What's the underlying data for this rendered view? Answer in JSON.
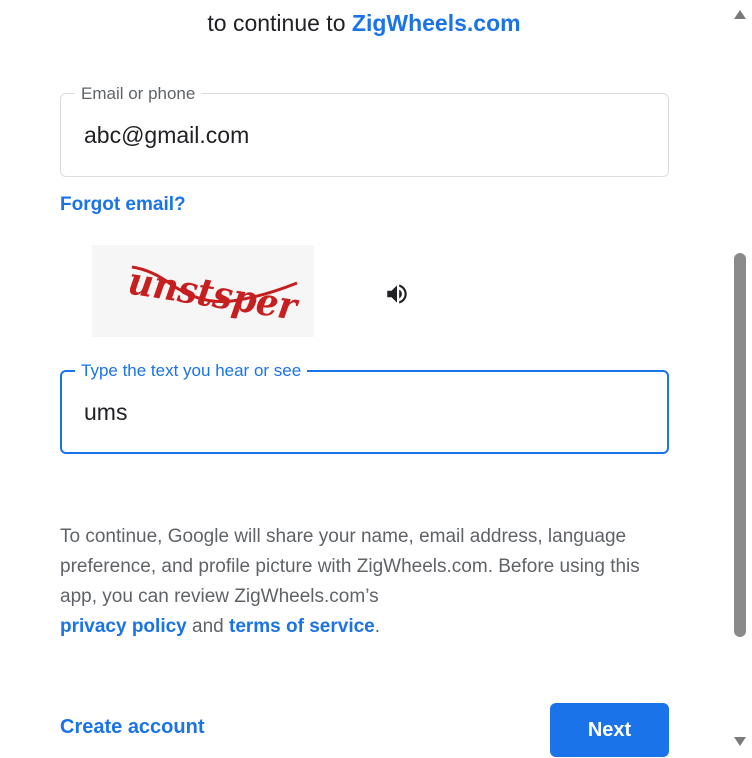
{
  "header": {
    "subtitle_prefix": "to continue to",
    "site_name": "ZigWheels.com"
  },
  "email_field": {
    "label": "Email or phone",
    "value": "abc@gmail.com"
  },
  "forgot_email": "Forgot email?",
  "captcha": {
    "image_text": "unstsper",
    "input_label": "Type the text you hear or see",
    "input_value": "ums",
    "audio_icon": "speaker-icon"
  },
  "consent": {
    "text_1": "To continue, Google will share your name, email address, language preference, and profile picture with ZigWheels.com. Before using this app, you can review ZigWheels.com’s",
    "privacy_link": "privacy policy",
    "and": "and",
    "terms_link": "terms of service",
    "end": "."
  },
  "footer": {
    "create_account": "Create account",
    "next": "Next"
  },
  "colors": {
    "accent": "#1a73e8",
    "text_secondary": "#5f6368",
    "border": "#dadce0"
  }
}
